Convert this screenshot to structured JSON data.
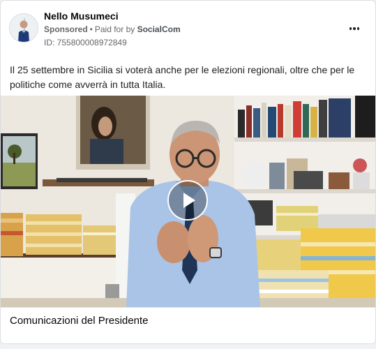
{
  "ad": {
    "page_name": "Nello Musumeci",
    "sponsored_label": "Sponsored",
    "separator": "•",
    "paid_for_prefix": "Paid for by",
    "paid_for_by": "SocialCom",
    "id_line": "ID: 755800008972849",
    "body_text": "Il 25 settembre in Sicilia si voterà anche per le elezioni regionali, oltre che per le politiche come avverrà in tutta Italia.",
    "media_type": "video",
    "caption": "Comunicazioni del Presidente"
  },
  "icons": {
    "more": "more-options-icon",
    "play": "play-icon",
    "avatar": "profile-avatar"
  },
  "colors": {
    "card_background": "#ffffff",
    "page_background": "#f0f2f5",
    "secondary_text": "#65676b",
    "primary_text": "#050505"
  }
}
